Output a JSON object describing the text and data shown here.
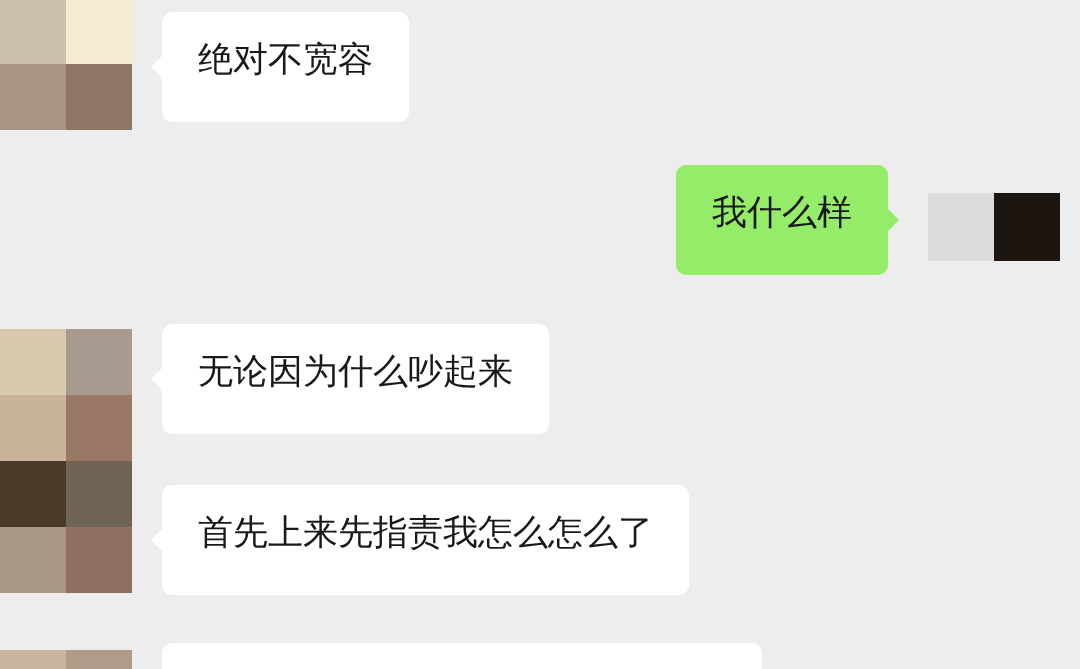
{
  "messages": [
    {
      "kind": "received",
      "text": "绝对不宽容"
    },
    {
      "kind": "sent",
      "text": "我什么样"
    },
    {
      "kind": "received",
      "text": "无论因为什么吵起来"
    },
    {
      "kind": "received",
      "text": "首先上来先指责我怎么怎么了"
    },
    {
      "kind": "received"
    }
  ]
}
